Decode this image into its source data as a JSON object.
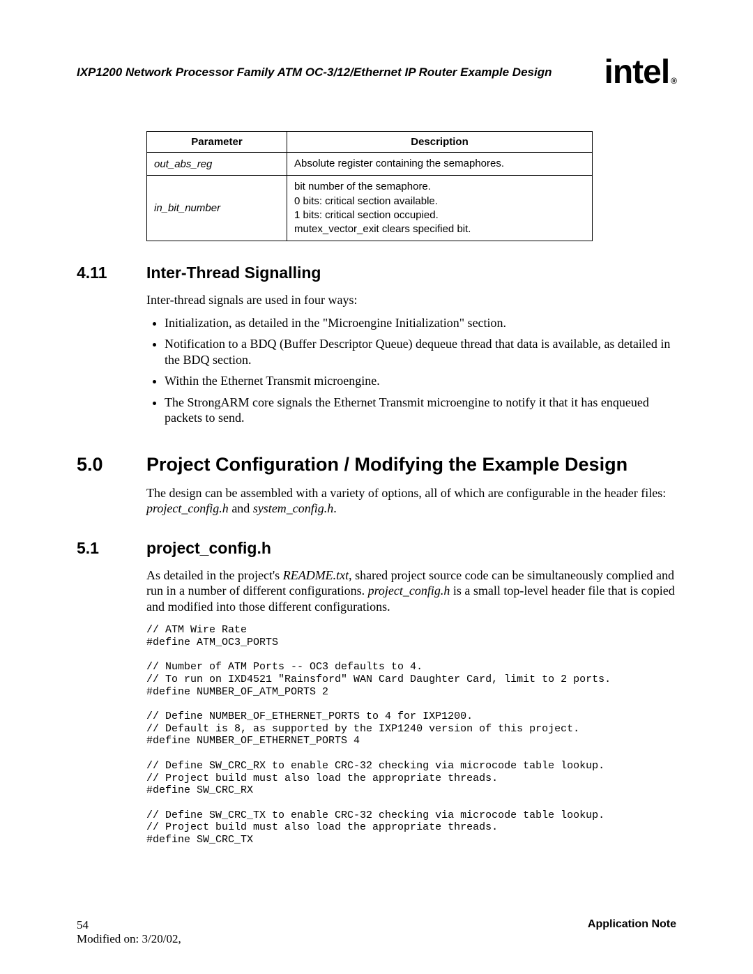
{
  "header": {
    "running_title": "IXP1200 Network Processor Family ATM OC-3/12/Ethernet IP Router Example Design",
    "logo_text": "intel",
    "logo_reg": "®"
  },
  "table": {
    "headers": {
      "param": "Parameter",
      "desc": "Description"
    },
    "rows": [
      {
        "param": "out_abs_reg",
        "desc": [
          "Absolute register containing the semaphores."
        ]
      },
      {
        "param": "in_bit_number",
        "desc": [
          "bit number of the semaphore.",
          "0 bits: critical section available.",
          "1 bits: critical section occupied.",
          "mutex_vector_exit clears specified bit."
        ]
      }
    ]
  },
  "sections": {
    "s411": {
      "num": "4.11",
      "title": "Inter-Thread Signalling"
    },
    "s50": {
      "num": "5.0",
      "title": "Project Configuration / Modifying the Example Design"
    },
    "s51": {
      "num": "5.1",
      "title": "project_config.h"
    }
  },
  "body": {
    "p411_intro": "Inter-thread signals are used in four ways:",
    "p411_bullets": [
      "Initialization, as detailed in the \"Microengine Initialization\" section.",
      "Notification to a BDQ (Buffer Descriptor Queue) dequeue thread that data is available, as detailed in the BDQ section.",
      "Within the Ethernet Transmit microengine.",
      "The StrongARM core signals the Ethernet Transmit microengine to notify it that it has enqueued packets to send."
    ],
    "p50_pre": "The design can be assembled with a variety of options, all of which are configurable in the header files: ",
    "p50_f1": "project_config.h",
    "p50_and": " and ",
    "p50_f2": "system_config.h",
    "p50_post": ".",
    "p51_pre": "As detailed in the project's ",
    "p51_readme": "README.txt",
    "p51_mid": ", shared project source code can be simultaneously complied and run in a number of different configurations. ",
    "p51_pc": "project_config.h",
    "p51_post": " is a small top-level header file that is copied and modified into those different configurations."
  },
  "code": "// ATM Wire Rate\n#define ATM_OC3_PORTS\n\n// Number of ATM Ports -- OC3 defaults to 4.\n// To run on IXD4521 \"Rainsford\" WAN Card Daughter Card, limit to 2 ports.\n#define NUMBER_OF_ATM_PORTS 2\n\n// Define NUMBER_OF_ETHERNET_PORTS to 4 for IXP1200.\n// Default is 8, as supported by the IXP1240 version of this project.\n#define NUMBER_OF_ETHERNET_PORTS 4\n\n// Define SW_CRC_RX to enable CRC-32 checking via microcode table lookup.\n// Project build must also load the appropriate threads.\n#define SW_CRC_RX\n\n// Define SW_CRC_TX to enable CRC-32 checking via microcode table lookup.\n// Project build must also load the appropriate threads.\n#define SW_CRC_TX",
  "footer": {
    "page_num": "54",
    "modified": "Modified on: 3/20/02,",
    "appnote": "Application Note"
  }
}
